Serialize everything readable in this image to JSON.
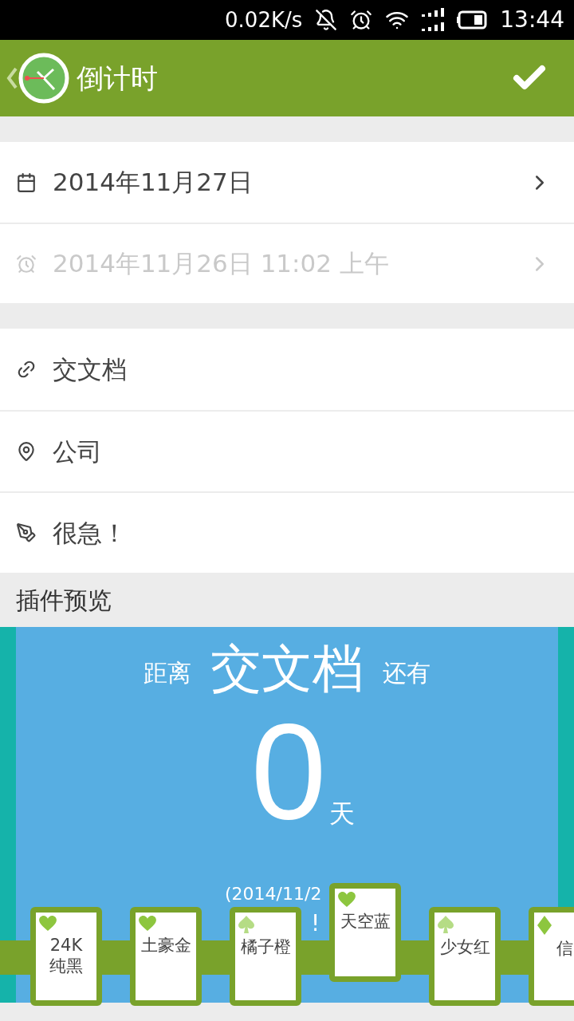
{
  "status_bar": {
    "speed": "0.02K/s",
    "time": "13:44"
  },
  "header": {
    "title": "倒计时"
  },
  "date_rows": [
    {
      "kind": "date",
      "text": "2014年11月27日",
      "disabled": false
    },
    {
      "kind": "alarm",
      "text": "2014年11月26日 11:02 上午",
      "disabled": true
    }
  ],
  "detail_rows": [
    {
      "kind": "link",
      "text": "交文档"
    },
    {
      "kind": "location",
      "text": "公司"
    },
    {
      "kind": "note",
      "text": "很急！"
    }
  ],
  "preview": {
    "heading": "插件预览",
    "prefix": "距离",
    "event": "交文档",
    "suffix": "还有",
    "count": "0",
    "unit": "天",
    "date_fragment": "(2014/11/2",
    "exclaim": "!"
  },
  "themes": [
    {
      "label": "24K\n纯黑",
      "kind": "heart",
      "selected": false
    },
    {
      "label": "土豪金",
      "kind": "heart",
      "selected": false
    },
    {
      "label": "橘子橙",
      "kind": "spade",
      "selected": false
    },
    {
      "label": "天空蓝",
      "kind": "heart",
      "selected": true
    },
    {
      "label": "少女红",
      "kind": "spade",
      "selected": false
    },
    {
      "label": "信",
      "kind": "diamond",
      "selected": false
    }
  ]
}
